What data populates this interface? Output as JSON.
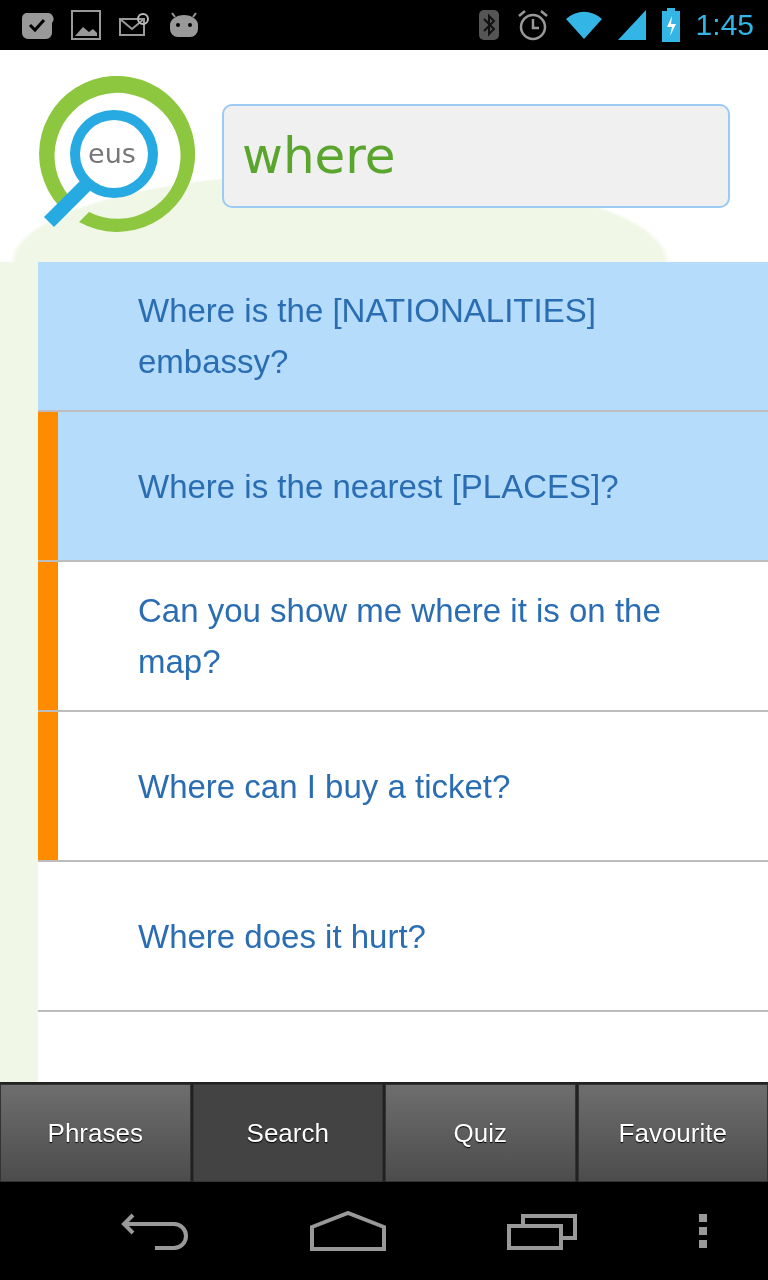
{
  "status_bar": {
    "time": "1:45"
  },
  "logo": {
    "text": "eus"
  },
  "search": {
    "value": "where"
  },
  "results": [
    {
      "text": "Where is the [NATIONALITIES] embassy?",
      "highlighted": true,
      "marked": false
    },
    {
      "text": "Where is the nearest [PLACES]?",
      "highlighted": true,
      "marked": true
    },
    {
      "text": "Can you show me where it is on the map?",
      "highlighted": false,
      "marked": true
    },
    {
      "text": "Where can I buy a ticket?",
      "highlighted": false,
      "marked": true
    },
    {
      "text": "Where does it hurt?",
      "highlighted": false,
      "marked": false
    }
  ],
  "tabs": [
    {
      "label": "Phrases",
      "selected": false
    },
    {
      "label": "Search",
      "selected": true
    },
    {
      "label": "Quiz",
      "selected": false
    },
    {
      "label": "Favourite",
      "selected": false
    }
  ]
}
